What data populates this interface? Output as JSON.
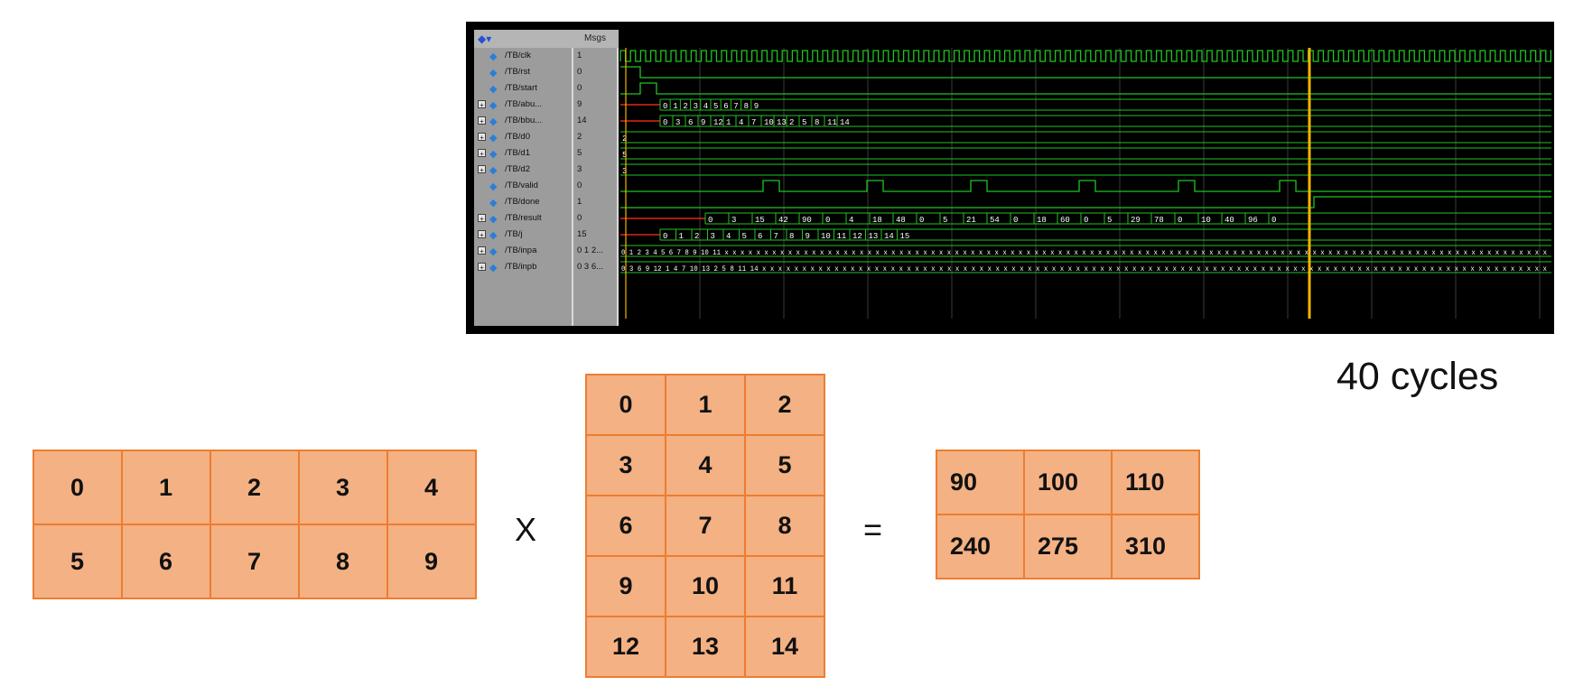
{
  "waveform": {
    "msgs_header": "Msgs",
    "signals": [
      {
        "name": "/TB/clk",
        "msg": "1",
        "expandable": false
      },
      {
        "name": "/TB/rst",
        "msg": "0",
        "expandable": false
      },
      {
        "name": "/TB/start",
        "msg": "0",
        "expandable": false
      },
      {
        "name": "/TB/abu...",
        "msg": "9",
        "expandable": true
      },
      {
        "name": "/TB/bbu...",
        "msg": "14",
        "expandable": true
      },
      {
        "name": "/TB/d0",
        "msg": "2",
        "expandable": true
      },
      {
        "name": "/TB/d1",
        "msg": "5",
        "expandable": true
      },
      {
        "name": "/TB/d2",
        "msg": "3",
        "expandable": true
      },
      {
        "name": "/TB/valid",
        "msg": "0",
        "expandable": false
      },
      {
        "name": "/TB/done",
        "msg": "1",
        "expandable": false
      },
      {
        "name": "/TB/result",
        "msg": "0",
        "expandable": true
      },
      {
        "name": "/TB/j",
        "msg": "15",
        "expandable": true
      },
      {
        "name": "/TB/inpa",
        "msg": "0 1 2...",
        "expandable": true
      },
      {
        "name": "/TB/inpb",
        "msg": "0 3 6...",
        "expandable": true
      }
    ],
    "bus_values": {
      "abu": [
        "0",
        "1",
        "2",
        "3",
        "4",
        "5",
        "6",
        "7",
        "8",
        "9"
      ],
      "bbu": [
        "0",
        "3",
        "6",
        "9",
        "12",
        "1",
        "4",
        "7",
        "10",
        "13",
        "2",
        "5",
        "8",
        "11",
        "14"
      ],
      "d0": "2",
      "d1": "5",
      "d2": "3",
      "result": [
        "0",
        "3",
        "15",
        "42",
        "90",
        "0",
        "4",
        "18",
        "48",
        "0",
        "5",
        "21",
        "54",
        "0",
        "18",
        "60",
        "0",
        "5",
        "29",
        "78",
        "0",
        "10",
        "40",
        "96",
        "0"
      ],
      "j": [
        "0",
        "1",
        "2",
        "3",
        "4",
        "5",
        "6",
        "7",
        "8",
        "9",
        "10",
        "11",
        "12",
        "13",
        "14",
        "15"
      ],
      "inpa": "0 1 2 3 4 5 6 7 8 9 10 11 x x x x x x x x x x x x x x x x x x x x x x x x x x x x x x x x x x x x x x x x x x x x x x x x x x x x x x x x x x x x x x x x x x x x x x x x x x x x x x x x x x x x x x x x x x x x x x x x x x x x x x x x",
      "inpb": "0 3 6 9 12 1 4 7 10 13 2 5 8 11 14 x x x x x x x x x x x x x x x x x x x x x x x x x x x x x x x x x x x x x x x x x x x x x x x x x x x x x x x x x x x x x x x x x x x x x x x x x x x x x x x x x x x x x x x x x x x x x x x x x x"
    },
    "colors": {
      "signal": "#22c222",
      "marker": "#f2b600",
      "reset": "#e0261b",
      "grid": "#3a3a3a"
    }
  },
  "cycles_label": "40 cycles",
  "matrix_a": [
    [
      "0",
      "1",
      "2",
      "3",
      "4"
    ],
    [
      "5",
      "6",
      "7",
      "8",
      "9"
    ]
  ],
  "matrix_b": [
    [
      "0",
      "1",
      "2"
    ],
    [
      "3",
      "4",
      "5"
    ],
    [
      "6",
      "7",
      "8"
    ],
    [
      "9",
      "10",
      "11"
    ],
    [
      "12",
      "13",
      "14"
    ]
  ],
  "matrix_c": [
    [
      "90",
      "100",
      "110"
    ],
    [
      "240",
      "275",
      "310"
    ]
  ],
  "operator_multiply": "X",
  "operator_equals": "=",
  "colors": {
    "cell_fill": "#f4b183",
    "cell_border": "#ed7d31"
  }
}
